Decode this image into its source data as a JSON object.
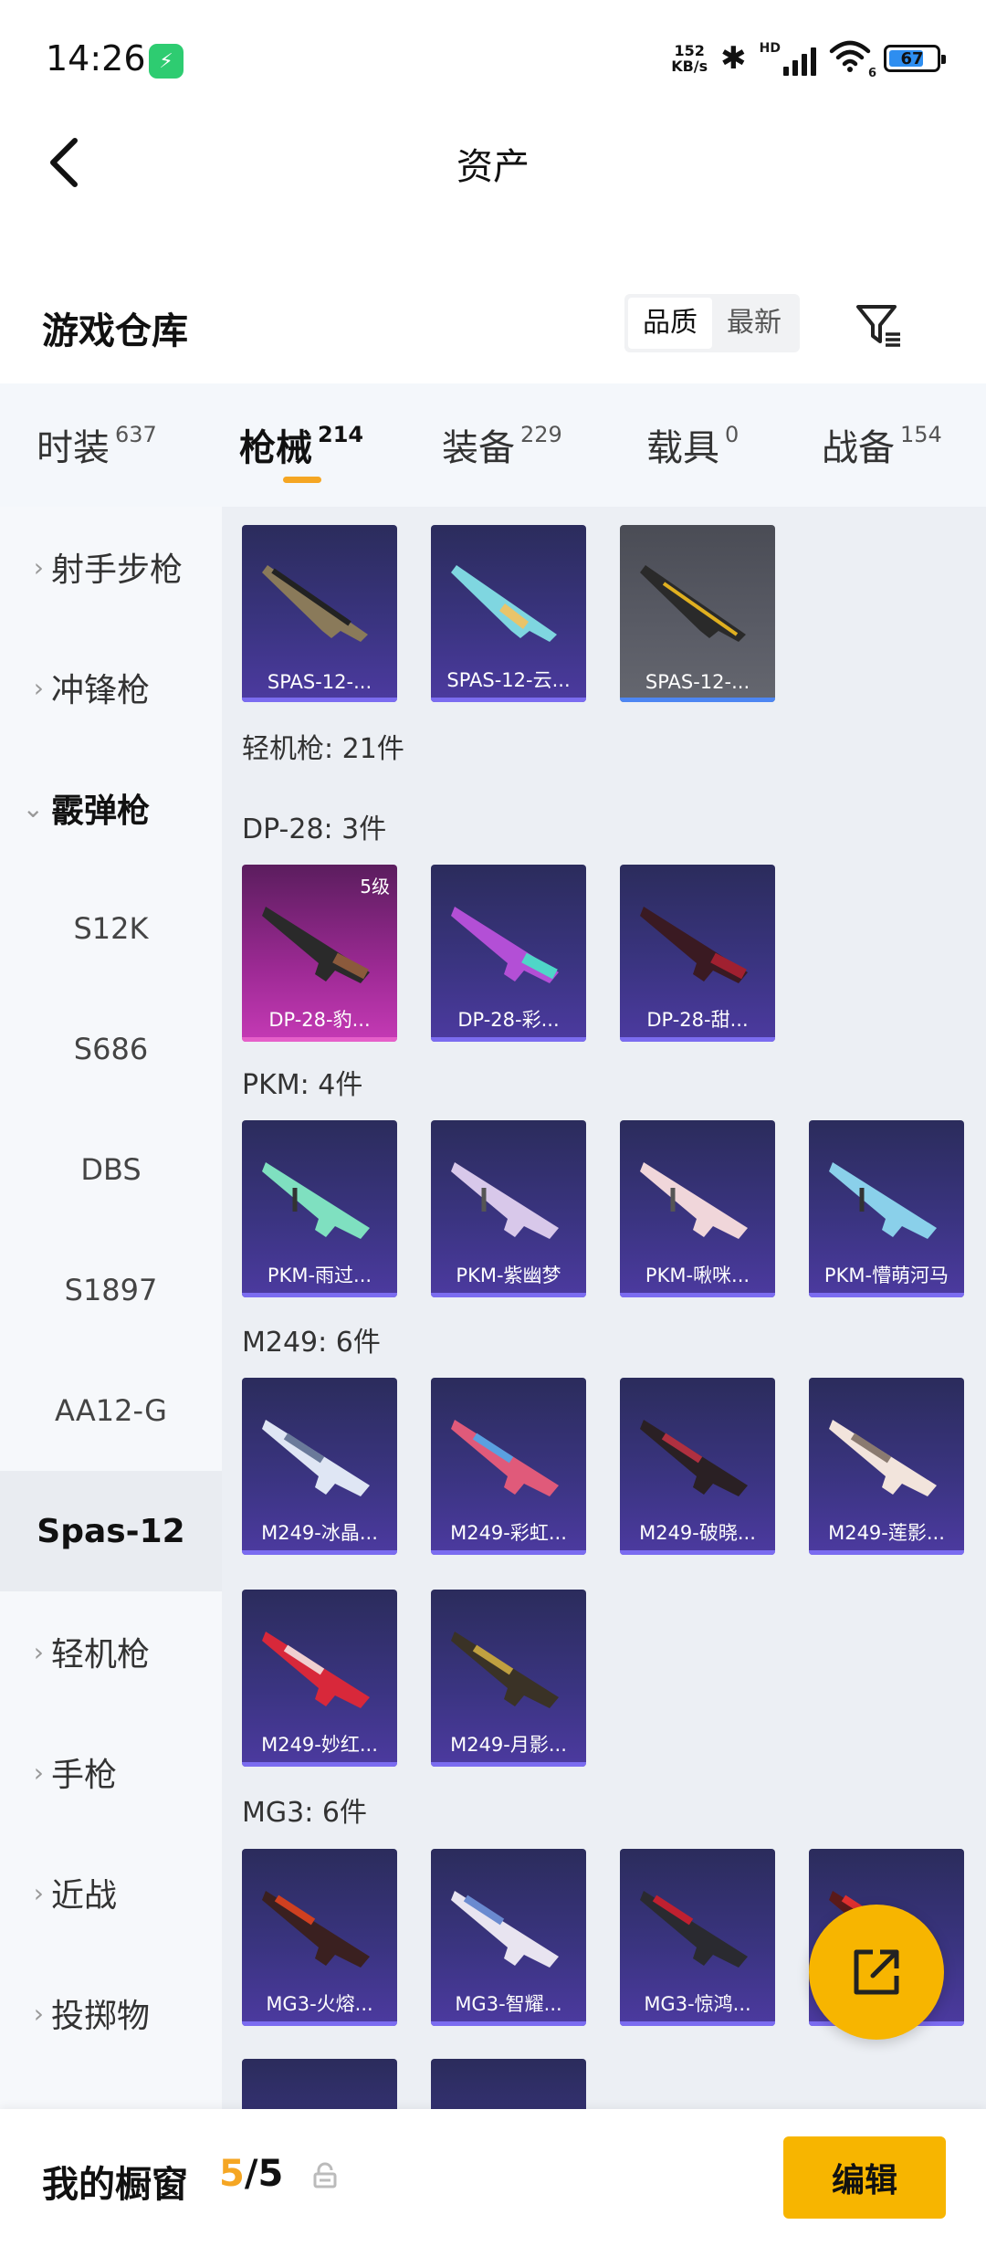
{
  "status_bar": {
    "time": "14:26",
    "speed_value": "152",
    "speed_unit": "KB/s",
    "network": "HD",
    "wifi_sub": "6",
    "battery": "67"
  },
  "header": {
    "title": "资产"
  },
  "warehouse": {
    "title": "游戏仓库",
    "sort_quality": "品质",
    "sort_latest": "最新"
  },
  "tabs": [
    {
      "label": "时装",
      "count": "637"
    },
    {
      "label": "枪械",
      "count": "214"
    },
    {
      "label": "装备",
      "count": "229"
    },
    {
      "label": "载具",
      "count": "0"
    },
    {
      "label": "战备",
      "count": "154"
    }
  ],
  "sidebar": {
    "items": [
      {
        "label": "射手步枪"
      },
      {
        "label": "冲锋枪"
      },
      {
        "label": "霰弹枪"
      },
      {
        "label": "S12K"
      },
      {
        "label": "S686"
      },
      {
        "label": "DBS"
      },
      {
        "label": "S1897"
      },
      {
        "label": "AA12-G"
      },
      {
        "label": "Spas-12"
      },
      {
        "label": "轻机枪"
      },
      {
        "label": "手枪"
      },
      {
        "label": "近战"
      },
      {
        "label": "投掷物"
      }
    ]
  },
  "content": {
    "top_items": [
      "SPAS-12-...",
      "SPAS-12-云...",
      "SPAS-12-..."
    ],
    "lmg_header": "轻机枪: 21件",
    "groups": [
      {
        "title": "DP-28: 3件",
        "items": [
          "DP-28-豹...",
          "DP-28-彩...",
          "DP-28-甜..."
        ]
      },
      {
        "title": "PKM: 4件",
        "items": [
          "PKM-雨过...",
          "PKM-紫幽梦",
          "PKM-啾咪...",
          "PKM-懵萌河马"
        ]
      },
      {
        "title": "M249: 6件",
        "items": [
          "M249-冰晶...",
          "M249-彩虹...",
          "M249-破晓...",
          "M249-莲影...",
          "M249-妙红...",
          "M249-月影..."
        ]
      },
      {
        "title": "MG3: 6件",
        "items": [
          "MG3-火熔...",
          "MG3-智耀...",
          "MG3-惊鸿...",
          ""
        ]
      }
    ],
    "level_badge": "5级"
  },
  "bottom_bar": {
    "title": "我的橱窗",
    "count_current": "5",
    "count_total": "/5",
    "edit_label": "编辑"
  },
  "colors": {
    "accent": "#f7b500",
    "tab_underline": "#f5a623",
    "card_purple": "#3a3480",
    "card_pink": "#9e2a95",
    "card_grey": "#5a5c66"
  }
}
